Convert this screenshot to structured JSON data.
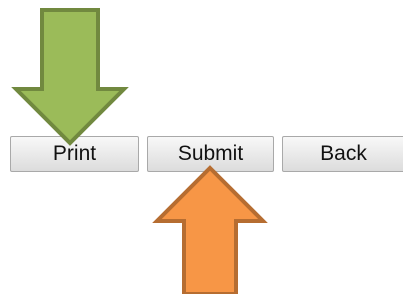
{
  "buttons": {
    "print_label": "Print",
    "submit_label": "Submit",
    "back_label": "Back"
  },
  "icons": {
    "down_arrow": "green-down-arrow-icon",
    "up_arrow": "orange-up-arrow-icon"
  },
  "colors": {
    "down_arrow_fill": "#9bbb59",
    "down_arrow_stroke": "#71893f",
    "up_arrow_fill": "#f79646",
    "up_arrow_stroke": "#b66d31"
  }
}
